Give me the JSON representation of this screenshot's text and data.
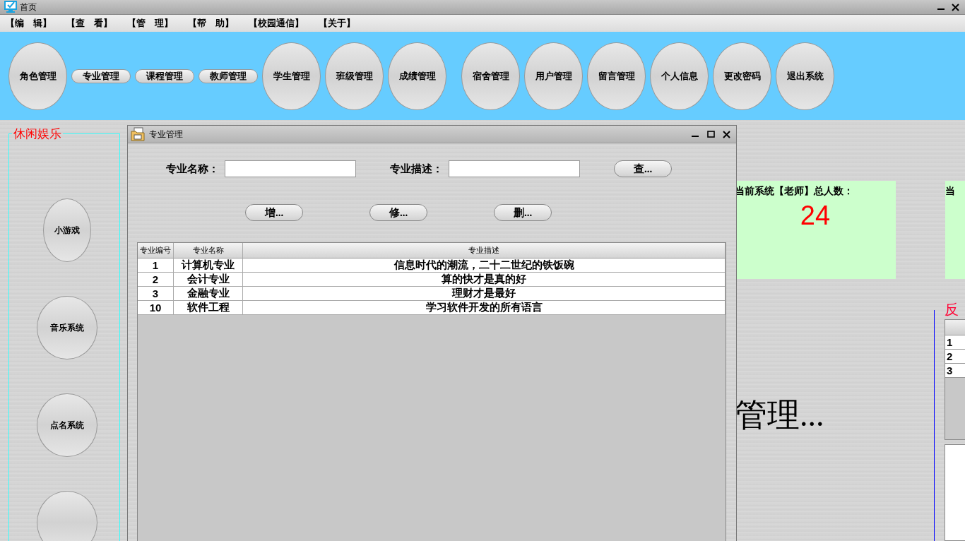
{
  "window": {
    "title": "首页"
  },
  "menu": [
    "【编　辑】",
    "【查　看】",
    "【管　理】",
    "【帮　助】",
    "【校园通信】",
    "【关于】"
  ],
  "toolbar": {
    "groups": [
      [
        {
          "label": "角色管理",
          "kind": "oval"
        },
        {
          "label": "专业管理",
          "kind": "pill"
        },
        {
          "label": "课程管理",
          "kind": "pill"
        },
        {
          "label": "教师管理",
          "kind": "pill"
        },
        {
          "label": "学生管理",
          "kind": "oval"
        },
        {
          "label": "班级管理",
          "kind": "oval"
        },
        {
          "label": "成绩管理",
          "kind": "oval"
        }
      ],
      [
        {
          "label": "宿舍管理",
          "kind": "oval"
        },
        {
          "label": "用户管理",
          "kind": "oval"
        },
        {
          "label": "留言管理",
          "kind": "oval"
        },
        {
          "label": "个人信息",
          "kind": "oval"
        },
        {
          "label": "更改密码",
          "kind": "oval"
        },
        {
          "label": "退出系统",
          "kind": "oval"
        }
      ]
    ]
  },
  "sidebar": {
    "title": "休闲娱乐",
    "buttons": [
      {
        "kind": "labeled",
        "label": "小游戏"
      },
      {
        "kind": "labeled",
        "label": "音乐系统"
      },
      {
        "kind": "labeled",
        "label": "点名系统"
      },
      {
        "kind": "cut"
      }
    ]
  },
  "stats": [
    {
      "label": "当前系统【老师】总人数：",
      "value": "24"
    },
    {
      "label": "当"
    }
  ],
  "banner": "管理...",
  "feedback": {
    "title": "反",
    "rows": [
      [
        "1"
      ],
      [
        "2"
      ],
      [
        "3"
      ]
    ]
  },
  "dialog": {
    "title": "专业管理",
    "fields": [
      {
        "label": "专业名称："
      },
      {
        "label": "专业描述："
      }
    ],
    "search_button": "查...",
    "actions": [
      "增...",
      "修...",
      "删..."
    ],
    "table": {
      "columns": [
        "专业编号",
        "专业名称",
        "专业描述"
      ],
      "rows": [
        [
          "1",
          "计算机专业",
          "信息时代的潮流，二十二世纪的铁饭碗"
        ],
        [
          "2",
          "会计专业",
          "算的快才是真的好"
        ],
        [
          "3",
          "金融专业",
          "理财才是最好"
        ],
        [
          "10",
          "软件工程",
          "学习软件开发的所有语言"
        ]
      ]
    }
  }
}
